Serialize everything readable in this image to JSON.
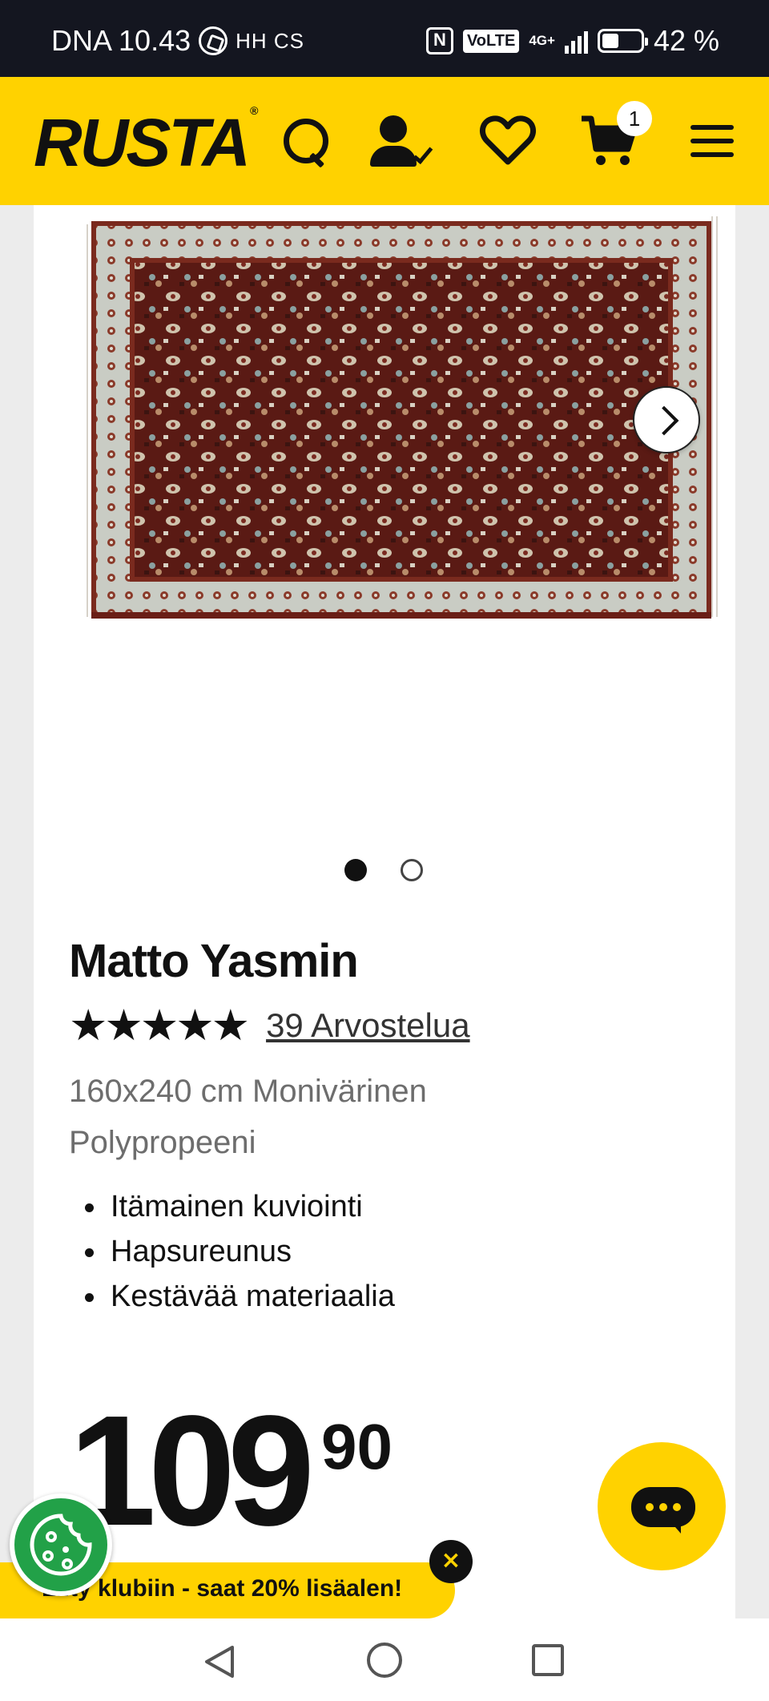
{
  "status_bar": {
    "carrier_time": "DNA 10.43",
    "extra_icons": "HH CS",
    "volte": "VoLTE",
    "network": "4G+",
    "battery": "42 %"
  },
  "header": {
    "logo": "RUSTA",
    "logo_mark": "®",
    "cart_count": "1",
    "brand_color": "#ffd200"
  },
  "carousel": {
    "slides": 2,
    "active_slide": 1
  },
  "product": {
    "title": "Matto Yasmin",
    "stars": "★★★★★",
    "rating_value": 5,
    "reviews_label": "39 Arvostelua",
    "subtitle": "160x240 cm Monivärinen Polypropeeni",
    "features": [
      "Itämainen kuviointi",
      "Hapsureunus",
      "Kestävää materiaalia"
    ],
    "price_main": "109",
    "price_decimals": "90"
  },
  "promo": {
    "text": "Liity klubiin - saat 20% lisäalen!",
    "close": "×"
  },
  "icons": [
    "search-icon",
    "account-icon",
    "heart-icon",
    "cart-icon",
    "menu-icon",
    "chevron-right-icon",
    "chat-icon",
    "cookie-icon",
    "back-icon",
    "home-icon",
    "recents-icon"
  ]
}
